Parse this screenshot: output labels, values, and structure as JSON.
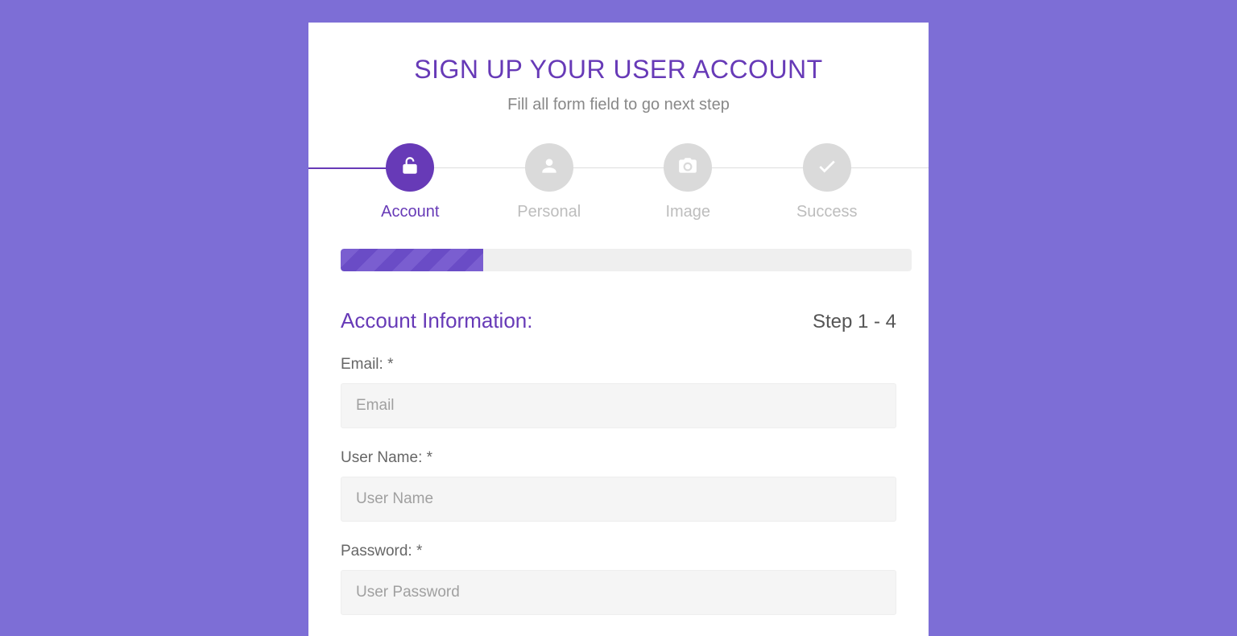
{
  "header": {
    "title": "SIGN UP YOUR USER ACCOUNT",
    "subtitle": "Fill all form field to go next step"
  },
  "steps": [
    {
      "label": "Account",
      "icon": "lock-open-icon",
      "active": true
    },
    {
      "label": "Personal",
      "icon": "user-icon",
      "active": false
    },
    {
      "label": "Image",
      "icon": "camera-icon",
      "active": false
    },
    {
      "label": "Success",
      "icon": "check-icon",
      "active": false
    }
  ],
  "progress_percent": 25,
  "section": {
    "title": "Account Information:",
    "step_text": "Step 1 - 4"
  },
  "fields": {
    "email": {
      "label": "Email: *",
      "placeholder": "Email"
    },
    "username": {
      "label": "User Name: *",
      "placeholder": "User Name"
    },
    "password": {
      "label": "Password: *",
      "placeholder": "User Password"
    }
  }
}
